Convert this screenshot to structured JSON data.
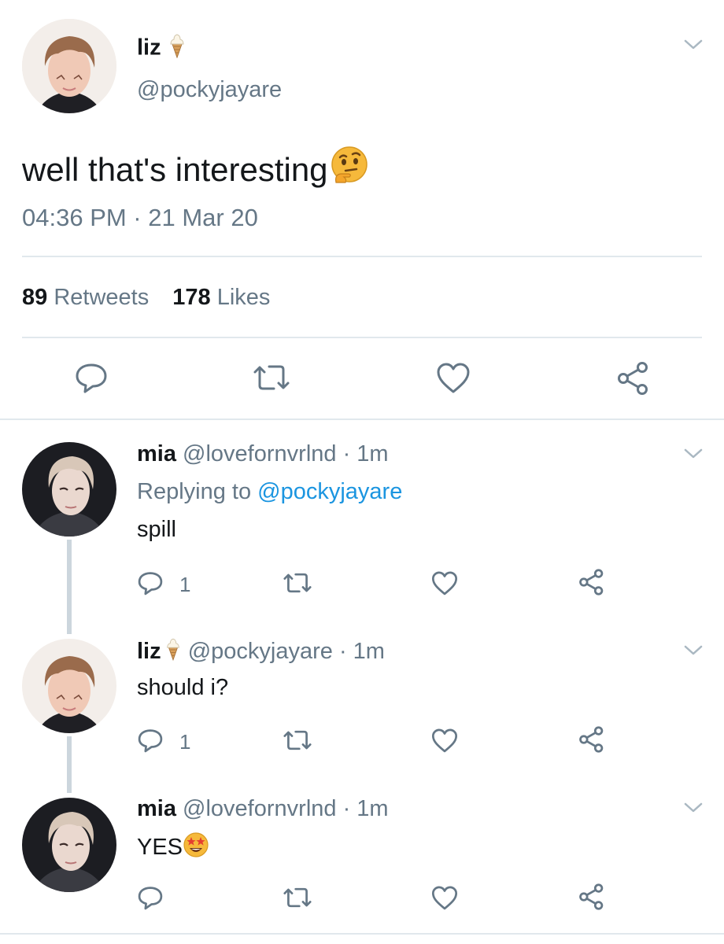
{
  "main_tweet": {
    "display_name": "liz",
    "handle": "@pockyjayare",
    "text": "well that's interesting",
    "emoji": "thinking-face-emoji",
    "timestamp": "04:36 PM · 21 Mar 20",
    "retweets_count": "89",
    "retweets_label": "Retweets",
    "likes_count": "178",
    "likes_label": "Likes"
  },
  "replies": [
    {
      "display_name": "mia",
      "handle": "@lovefornvrlnd",
      "time": "· 1m",
      "replying_prefix": "Replying to",
      "replying_handle": "@pockyjayare",
      "text": "spill",
      "reply_count": "1"
    },
    {
      "display_name": "liz",
      "handle": "@pockyjayare",
      "time": "· 1m",
      "text": "should i?",
      "reply_count": "1"
    },
    {
      "display_name": "mia",
      "handle": "@lovefornvrlnd",
      "time": "· 1m",
      "text": "YES",
      "emoji": "star-struck-emoji"
    }
  ],
  "colors": {
    "text": "#14171a",
    "secondary": "#657786",
    "link": "#1b95e0",
    "divider": "#e1e8ed",
    "thread_line": "#ccd6dd"
  }
}
